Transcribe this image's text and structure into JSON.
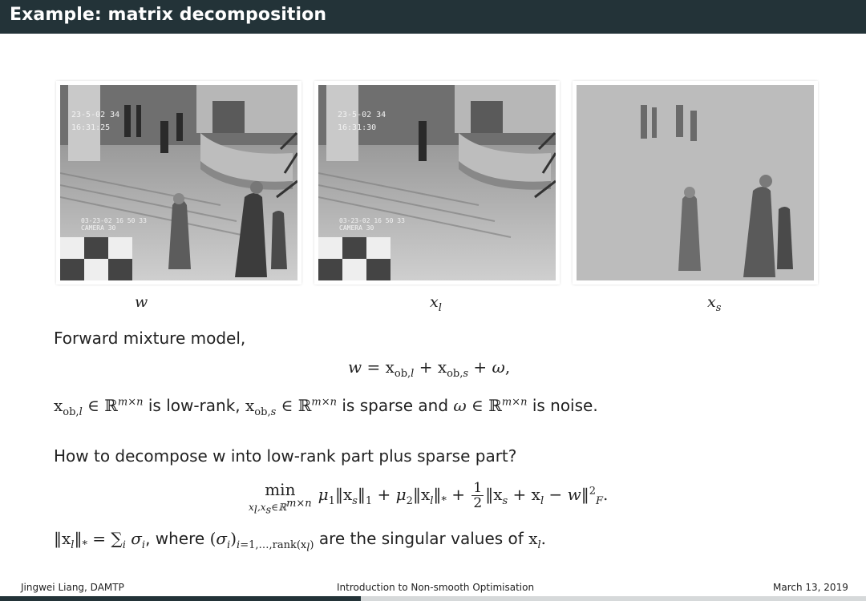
{
  "slide": {
    "title": "Example: matrix decomposition"
  },
  "images": [
    {
      "caption_main": "w",
      "caption_sub": ""
    },
    {
      "caption_main": "x",
      "caption_sub": "l"
    },
    {
      "caption_main": "x",
      "caption_sub": "s"
    }
  ],
  "overlay": {
    "timestamp_1": "23-5-02  34",
    "timestamp_2": "16:31:25",
    "timestamp_3": "16:31:30",
    "camera_date": "03-23-02 16 50 33",
    "camera_label": "CAMERA 30"
  },
  "body": {
    "line1": "Forward mixture model,",
    "eq1": "w = x_ob,l + x_ob,s + ω,",
    "line2_a": "is low-rank,",
    "line2_b": "is sparse and",
    "line2_c": "is noise.",
    "line3": "How to decompose w into low-rank part plus sparse part?",
    "line4_a": ", where",
    "line4_b": "are the singular values of"
  },
  "footer": {
    "author": "Jingwei Liang, DAMTP",
    "course": "Introduction to Non-smooth Optimisation",
    "date": "March 13, 2019"
  },
  "progress": {
    "fraction": 0.417
  },
  "colors": {
    "header_bg": "#233338",
    "progress_track": "#d6d9da"
  }
}
